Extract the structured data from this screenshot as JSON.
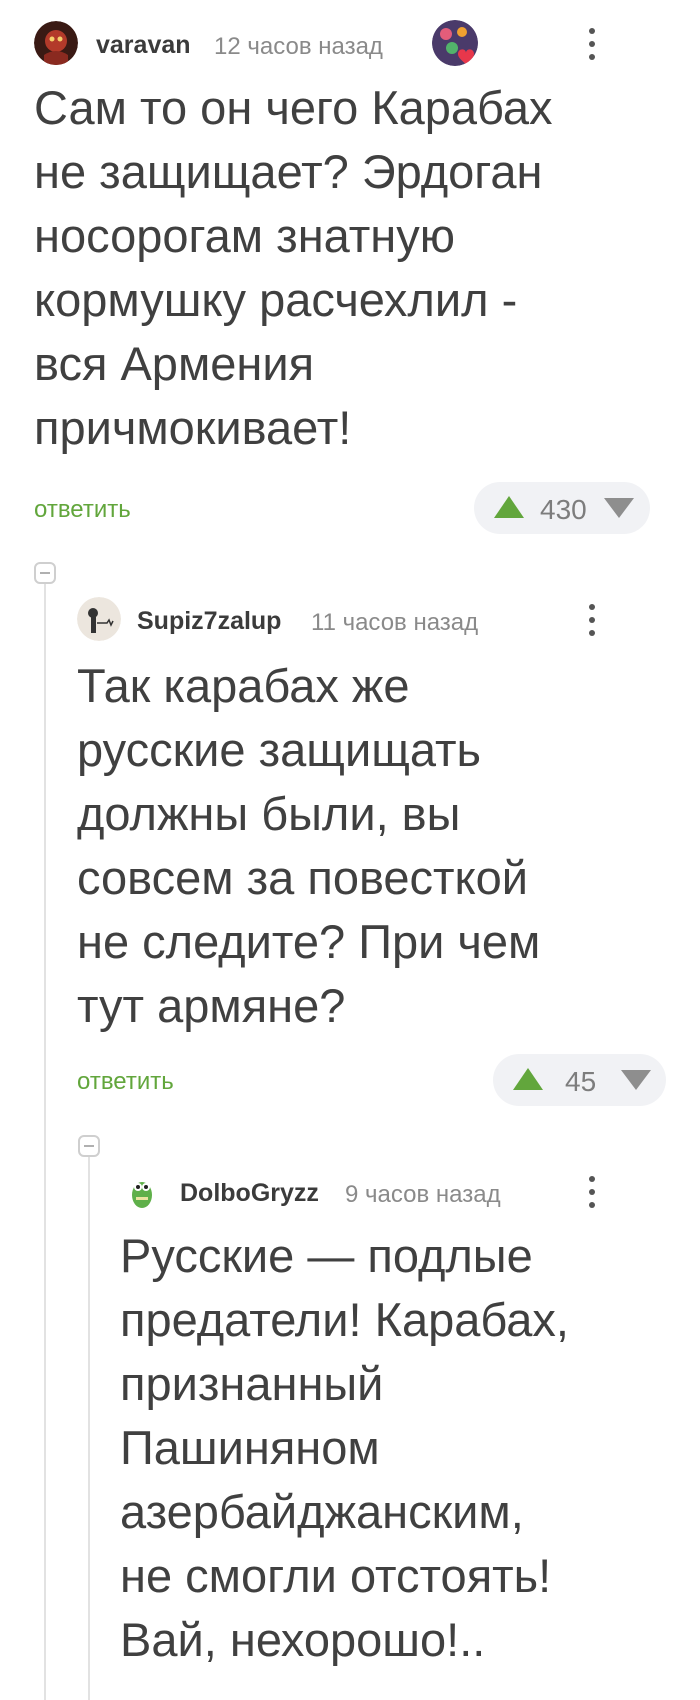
{
  "comments": [
    {
      "username": "varavan",
      "time": "12 часов назад",
      "text_lines": [
        "Сам то он чего Карабах",
        "не защищает? Эрдоган",
        "носорогам знатную",
        "кормушку расчехлил -",
        "вся Армения",
        "причмокивает!"
      ],
      "reply_label": "ответить",
      "rating": "430"
    },
    {
      "username": "Supiz7zalup",
      "time": "11 часов назад",
      "text_lines": [
        "Так карабах же",
        "русские защищать",
        "должны были, вы",
        "совсем за повесткой",
        "не следите? При чем",
        "тут армяне?"
      ],
      "reply_label": "ответить",
      "rating": "45"
    },
    {
      "username": "DolboGryzz",
      "time": "9 часов назад",
      "text_lines": [
        "Русские — подлые",
        "предатели! Карабах,",
        "признанный",
        "Пашиняном",
        "азербайджанским,",
        "не смогли отстоять!",
        "Вай, нехорошо!.."
      ]
    }
  ],
  "colors": {
    "accent": "#62a63c",
    "text": "#404040",
    "meta": "#8a8a8a",
    "vote_bg": "#f1f2f5"
  }
}
